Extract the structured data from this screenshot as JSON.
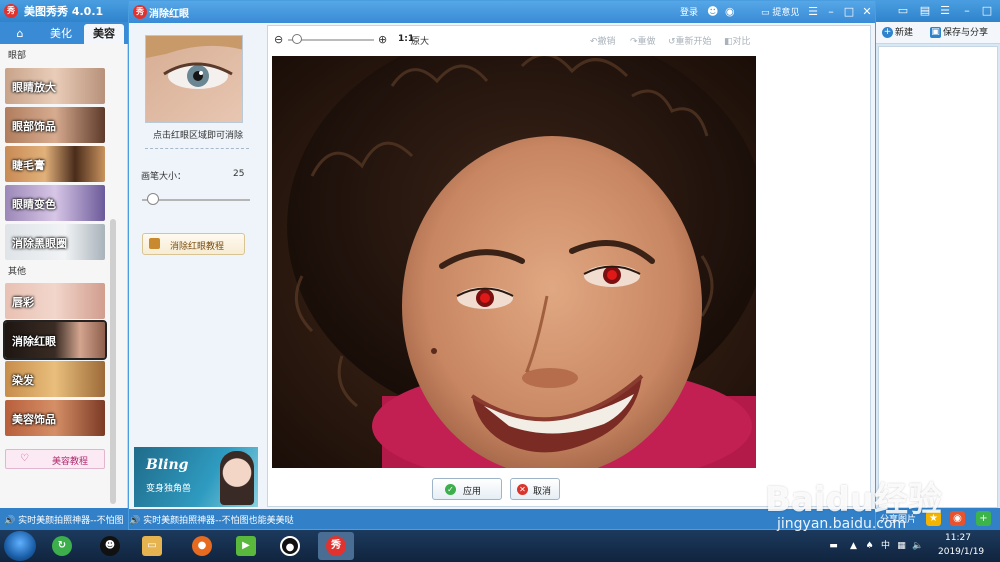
{
  "app": {
    "title": "美图秀秀 4.0.1",
    "logo_glyph": "秀",
    "tabs": [
      {
        "label": "",
        "icon": "home-icon"
      },
      {
        "label": "美化"
      },
      {
        "label": "美容"
      }
    ],
    "accent_color": "#3a8bd6"
  },
  "sidebar": {
    "section_eyes": "眼部",
    "section_other": "其他",
    "items": [
      {
        "label": "眼睛放大"
      },
      {
        "label": "眼部饰品"
      },
      {
        "label": "睫毛膏"
      },
      {
        "label": "眼睛变色"
      },
      {
        "label": "消除黑眼圈"
      },
      {
        "label": "唇彩"
      },
      {
        "label": "消除红眼"
      },
      {
        "label": "染发"
      },
      {
        "label": "美容饰品"
      }
    ],
    "tutorial_label": "美容教程"
  },
  "right_panel": {
    "new_label": "新建",
    "save_share_label": "保存与分享",
    "share_label": "分享图片"
  },
  "dialog": {
    "title": "消除红眼",
    "login": "登录",
    "feedback": "提意见",
    "hint": "点击红眼区域即可消除",
    "brush_label": "画笔大小：",
    "brush_value": "25",
    "brush_fraction": 0.1,
    "tutorial_label": "消除红眼教程",
    "ad_title": "Bling",
    "ad_subtitle": "变身独角兽",
    "zoom": {
      "one_one": "1:1",
      "original": "原大",
      "fraction": 0.05
    },
    "actions": {
      "undo": "撤销",
      "redo": "重做",
      "reset": "重新开始",
      "compare": "对比"
    },
    "apply_label": "应用",
    "cancel_label": "取消"
  },
  "ticker": {
    "text": "实时美颜拍照神器--不怕图也能美美哒",
    "text_short": "实时美颜拍照神器--不怕图"
  },
  "taskbar": {
    "time": "11:27",
    "date": "2019/1/19",
    "tray_lang": "中"
  },
  "watermark": {
    "text": "Baidu经验",
    "url": "jingyan.baidu.com"
  }
}
